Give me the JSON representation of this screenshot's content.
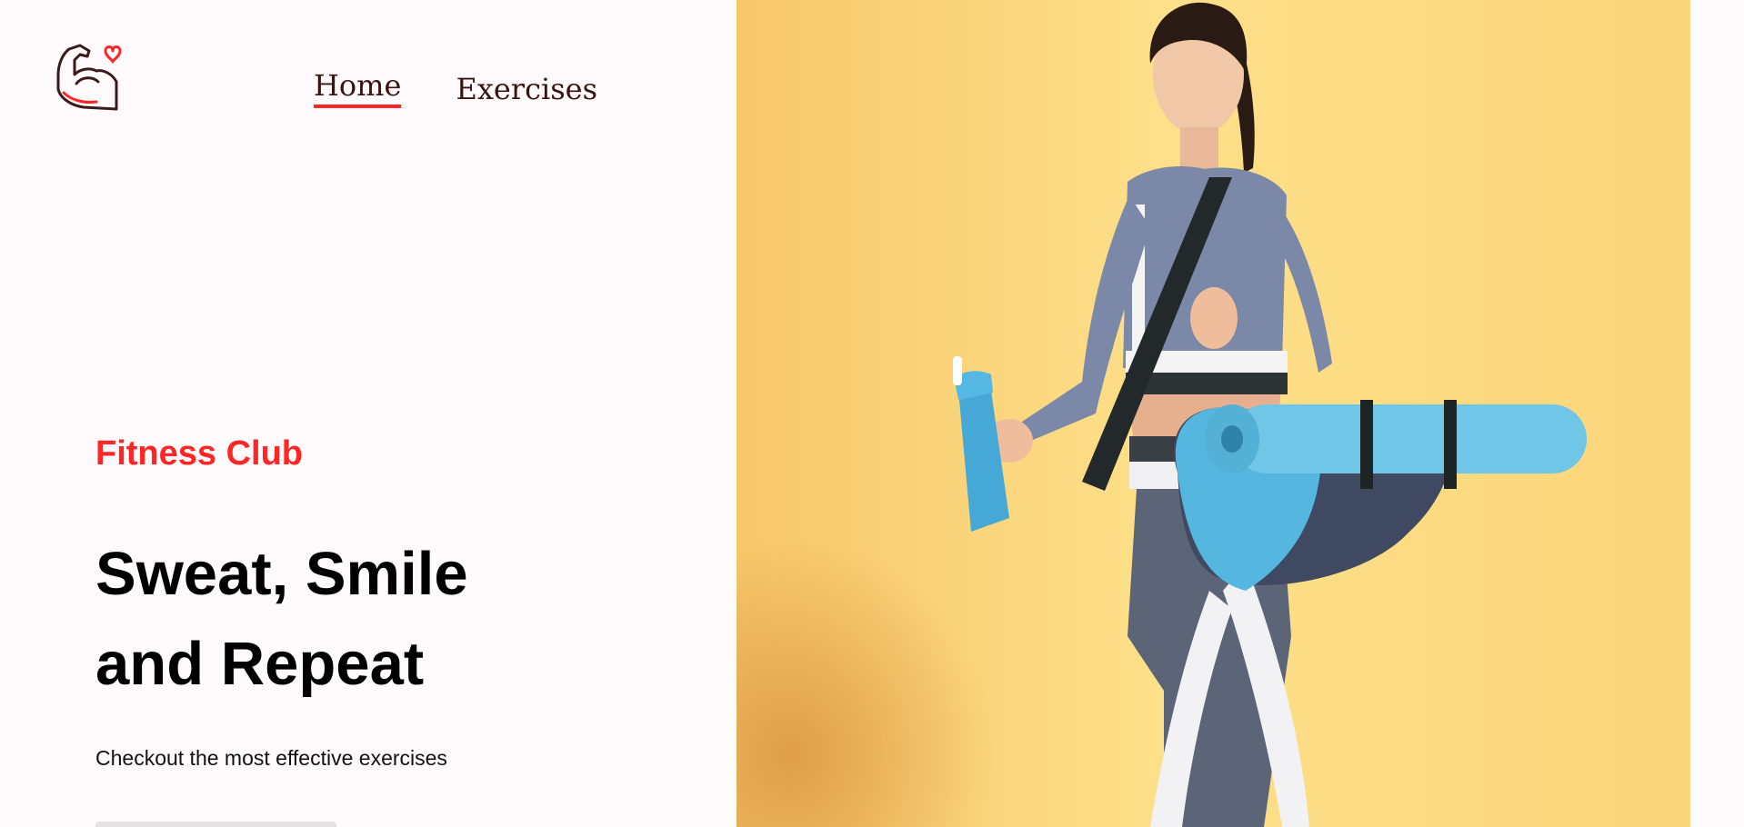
{
  "nav": {
    "links": [
      {
        "label": "Home",
        "active": true
      },
      {
        "label": "Exercises",
        "active": false
      }
    ]
  },
  "hero": {
    "tag": "Fitness Club",
    "title": "Sweat, Smile\nand Repeat",
    "subtitle": "Checkout the most effective exercises"
  },
  "colors": {
    "accent": "#ff2625",
    "page_background": "#fffafb",
    "banner_background": "#fde08a",
    "text_dark": "#000000",
    "nav_text": "#3a1212"
  },
  "icons": {
    "logo": "flexed-arm-with-heart-icon"
  }
}
